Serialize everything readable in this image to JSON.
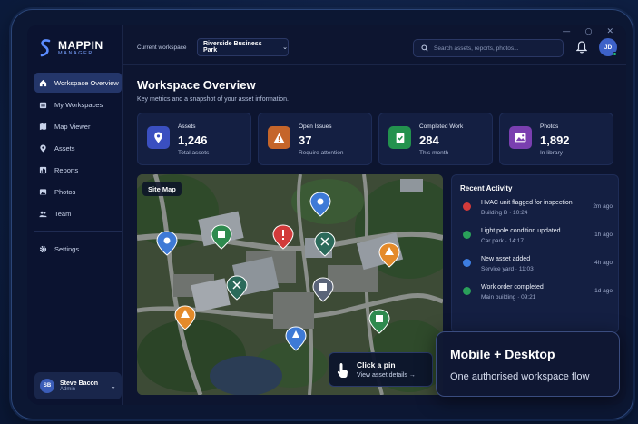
{
  "window": {
    "controls": [
      "—",
      "○",
      "✕"
    ]
  },
  "brand": {
    "title": "MAPPIN",
    "subtitle": "MANAGER"
  },
  "sidebar": {
    "items": [
      {
        "label": "Workspace Overview",
        "icon": "home-icon",
        "active": true
      },
      {
        "label": "My Workspaces",
        "icon": "folder-icon"
      },
      {
        "label": "Map Viewer",
        "icon": "map-icon"
      },
      {
        "label": "Assets",
        "icon": "pin-icon"
      },
      {
        "label": "Reports",
        "icon": "report-icon"
      },
      {
        "label": "Photos",
        "icon": "photo-icon"
      },
      {
        "label": "Team",
        "icon": "team-icon"
      }
    ],
    "settings": {
      "label": "Settings",
      "icon": "gear-icon"
    },
    "user": {
      "initials": "SB",
      "name": "Steve Bacon",
      "role": "Admin"
    }
  },
  "topbar": {
    "workspace_label": "Current workspace",
    "workspace_value": "Riverside Business Park",
    "search_placeholder": "Search assets, reports, photos...",
    "user_initials": "JD"
  },
  "main": {
    "title": "Workspace Overview",
    "subtitle": "Key metrics and a snapshot of your asset information.",
    "cards": [
      {
        "label": "Assets",
        "value": "1,246",
        "caption": "Total assets",
        "color": "#3a4fc0",
        "icon": "pin-icon"
      },
      {
        "label": "Open Issues",
        "value": "37",
        "caption": "Require attention",
        "color": "#c5652a",
        "icon": "warning-icon"
      },
      {
        "label": "Completed Work",
        "value": "284",
        "caption": "This month",
        "color": "#23924e",
        "icon": "check-clipboard-icon"
      },
      {
        "label": "Photos",
        "value": "1,892",
        "caption": "In library",
        "color": "#7a3fb0",
        "icon": "image-icon"
      }
    ],
    "map": {
      "label": "Site Map",
      "hint_title": "Click a pin",
      "hint_link": "View asset details →"
    },
    "activity": {
      "title": "Recent Activity",
      "items": [
        {
          "title": "HVAC unit flagged for inspection",
          "sub": "Building B · 10:24",
          "time": "2m ago",
          "color": "#d23a3a"
        },
        {
          "title": "Light pole condition updated",
          "sub": "Car park · 14:17",
          "time": "1h ago",
          "color": "#2aa05a"
        },
        {
          "title": "New asset added",
          "sub": "Service yard · 11:03",
          "time": "4h ago",
          "color": "#3d7de0"
        },
        {
          "title": "Work order completed",
          "sub": "Main building · 09:21",
          "time": "1d ago",
          "color": "#2aa05a"
        }
      ]
    }
  },
  "promo": {
    "title": "Mobile + Desktop",
    "subtitle": "One authorised workspace flow"
  }
}
